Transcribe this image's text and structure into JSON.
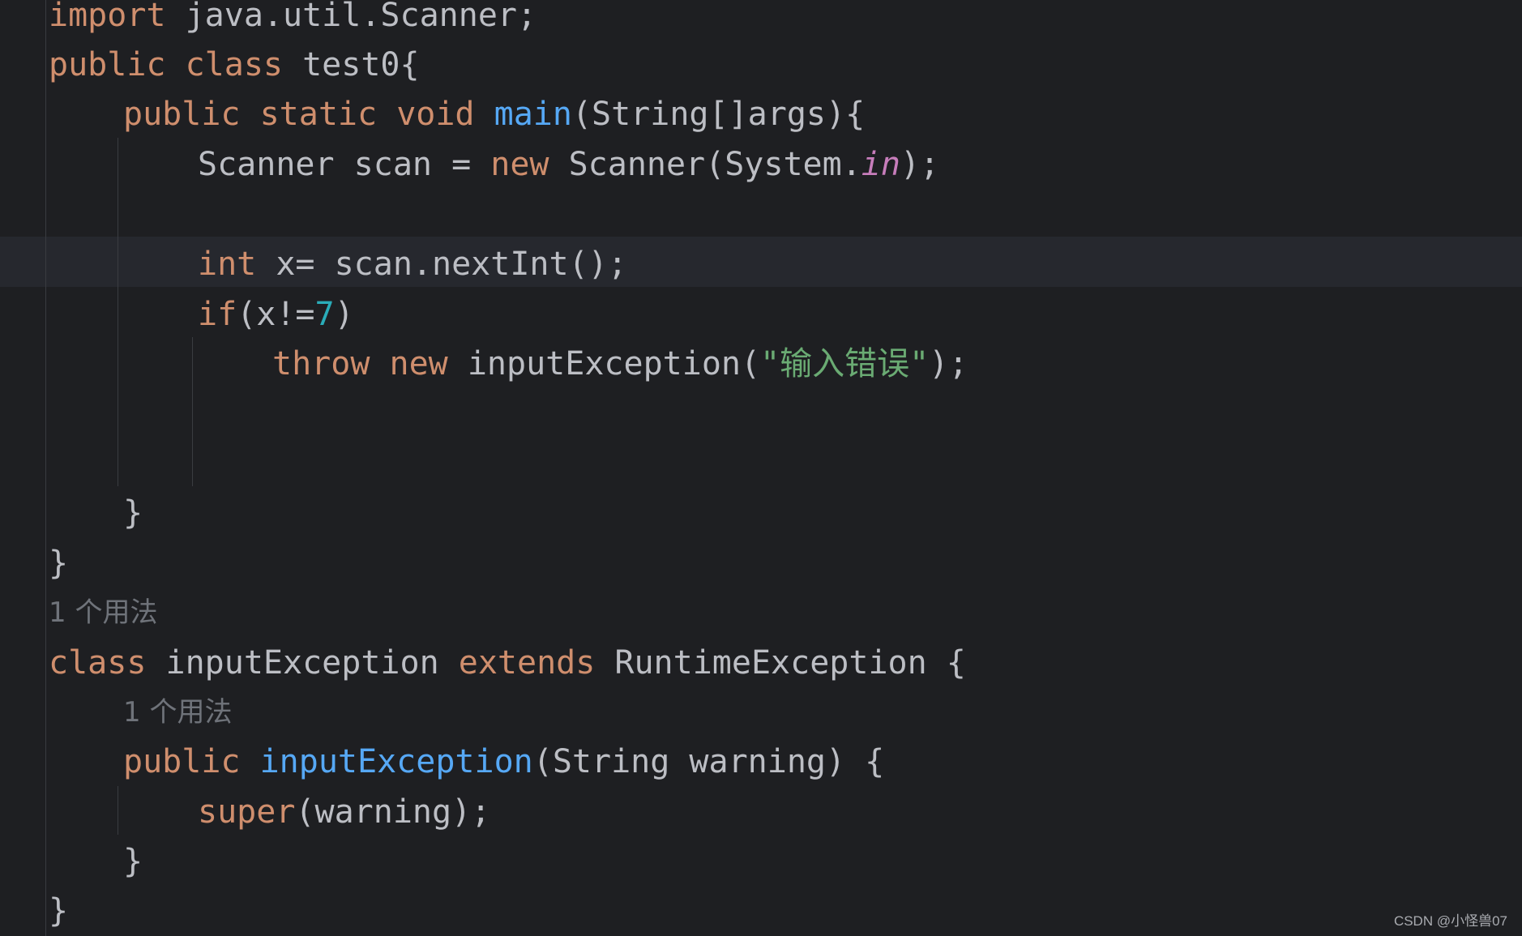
{
  "code_lines": {
    "l1": {
      "kw": "import",
      "rest": " java.util.Scanner;"
    },
    "l2": {
      "kw1": "public",
      "kw2": "class",
      "rest": " test0{"
    },
    "l3": {
      "kw1": "public",
      "kw2": "static",
      "kw3": "void",
      "fn": "main",
      "rest": "(String[]args){"
    },
    "l4": {
      "pre": "Scanner scan = ",
      "kw": "new",
      "mid": " Scanner(System.",
      "stat": "in",
      "end": ");"
    },
    "l6": {
      "kw": "int",
      "rest": " x= scan.nextInt();"
    },
    "l7": {
      "kw": "if",
      "pre": "(x!=",
      "num": "7",
      "end": ")"
    },
    "l8": {
      "kw1": "throw",
      "kw2": "new",
      "mid": " inputException(",
      "str": "\"输入错误\"",
      "end": ");"
    },
    "l11": {
      "text": "}"
    },
    "l12": {
      "text": "}"
    },
    "h1": {
      "text": "1 个用法"
    },
    "l14": {
      "kw1": "class",
      "mid": " inputException ",
      "kw2": "extends",
      "rest": " RuntimeException {"
    },
    "h2": {
      "text": "1 个用法"
    },
    "l16": {
      "kw": "public",
      "fn": "inputException",
      "rest": "(String warning) {"
    },
    "l17": {
      "kw": "super",
      "rest": "(warning);"
    },
    "l18": {
      "text": "}"
    },
    "l19": {
      "text": "}"
    }
  },
  "watermark": "CSDN @小怪兽07"
}
